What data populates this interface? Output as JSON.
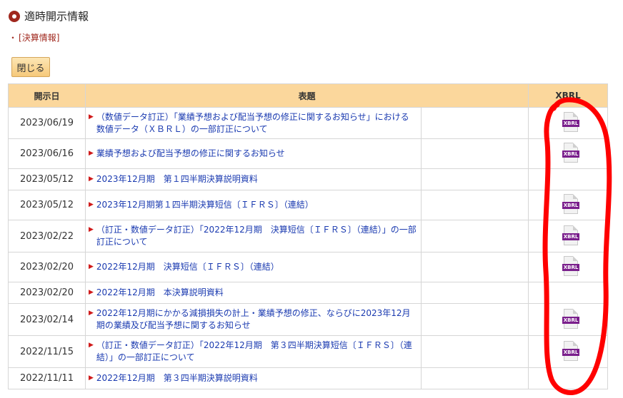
{
  "header": {
    "title": "適時開示情報"
  },
  "sub_link": {
    "bullet": "・",
    "label": "[決算情報]"
  },
  "close_button": {
    "label": "閉じる"
  },
  "table": {
    "columns": {
      "date": "開示日",
      "title": "表題",
      "xbrl": "XBRL"
    },
    "rows": [
      {
        "date": "2023/06/19",
        "title": "（数値データ訂正）「業績予想および配当予想の修正に関するお知らせ」における 数値データ（ＸＢＲＬ）の一部訂正について",
        "xbrl": "XBRL"
      },
      {
        "date": "2023/06/16",
        "title": "業績予想および配当予想の修正に関するお知らせ",
        "xbrl": "XBRL"
      },
      {
        "date": "2023/05/12",
        "title": "2023年12月期　第１四半期決算説明資料",
        "xbrl": ""
      },
      {
        "date": "2023/05/12",
        "title": "2023年12月期第１四半期決算短信〔ＩＦＲＳ〕（連結）",
        "xbrl": "XBRL"
      },
      {
        "date": "2023/02/22",
        "title": "（訂正・数値データ訂正）「2022年12月期　決算短信〔ＩＦＲＳ〕（連結）」の一部訂正について",
        "xbrl": "XBRL"
      },
      {
        "date": "2023/02/20",
        "title": "2022年12月期　決算短信〔ＩＦＲＳ〕（連結）",
        "xbrl": "XBRL"
      },
      {
        "date": "2023/02/20",
        "title": "2022年12月期　本決算説明資料",
        "xbrl": ""
      },
      {
        "date": "2023/02/14",
        "title": "2022年12月期にかかる減損損失の計上・業績予想の修正、ならびに2023年12月期の業績及び配当予想に関するお知らせ",
        "xbrl": "XBRL"
      },
      {
        "date": "2022/11/15",
        "title": "（訂正・数値データ訂正）「2022年12月期　第３四半期決算短信〔ＩＦＲＳ〕（連結）」の一部訂正について",
        "xbrl": "XBRL"
      },
      {
        "date": "2022/11/11",
        "title": "2022年12月期　第３四半期決算説明資料",
        "xbrl": ""
      }
    ]
  },
  "colors": {
    "accent": "#a0281e",
    "header_bg": "#fbd79c",
    "link": "#1a3ab0",
    "bullet_triangle": "#d01a1a",
    "xbrl_band": "#7a1f8c",
    "annotation_stroke": "#ff0000"
  }
}
